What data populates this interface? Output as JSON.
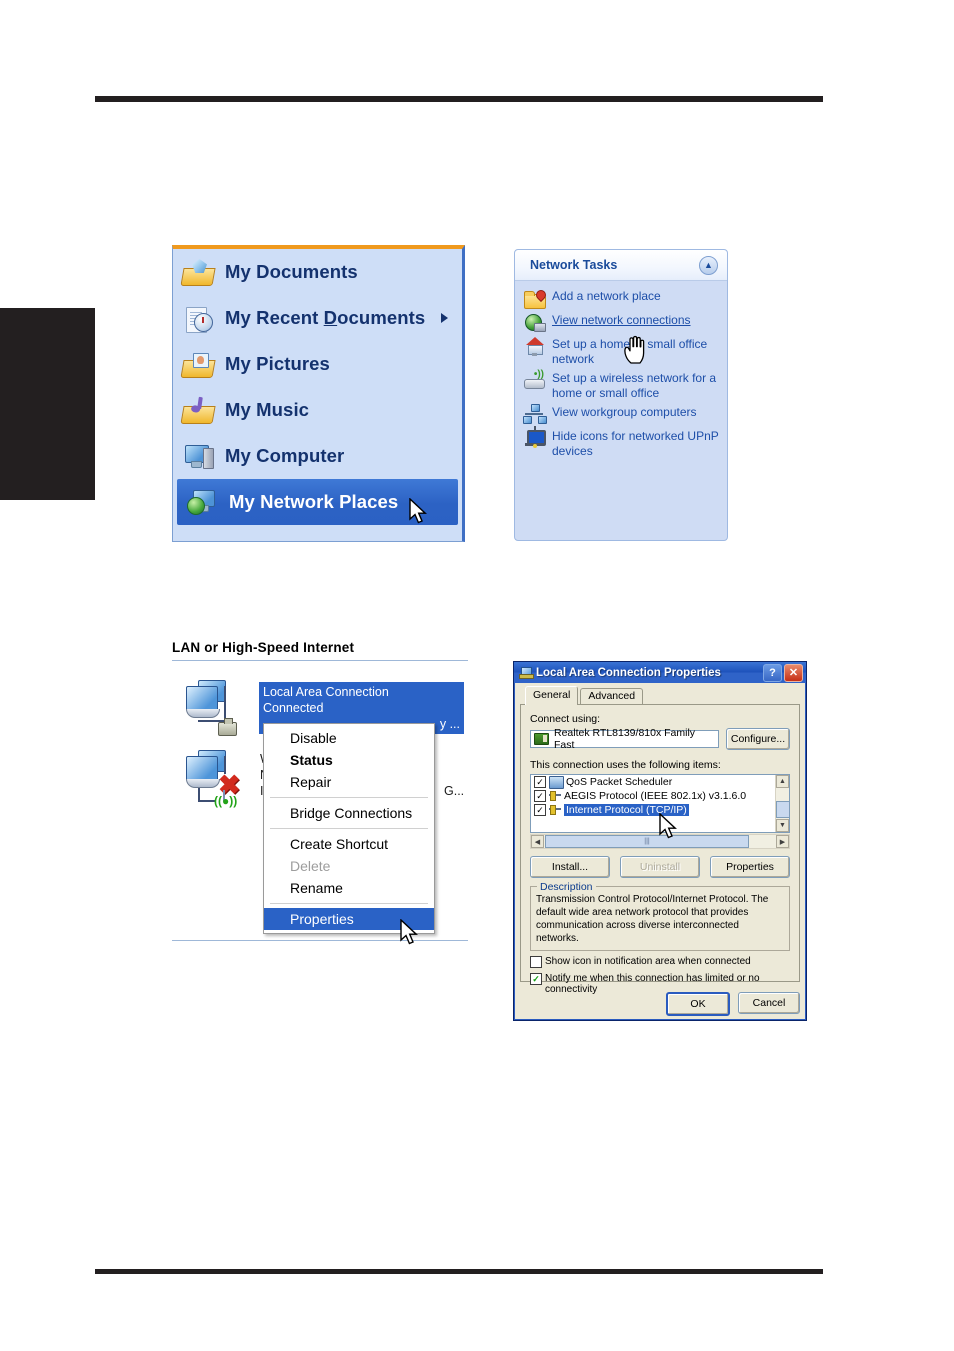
{
  "page": {
    "figures": 4
  },
  "start_menu": {
    "items": [
      {
        "label": "My Documents",
        "icon": "folder-documents-icon",
        "has_submenu": false,
        "selected": false
      },
      {
        "label": "My Recent Documents",
        "icon": "recent-documents-icon",
        "has_submenu": true,
        "selected": false,
        "accelerator": "D"
      },
      {
        "label": "My Pictures",
        "icon": "folder-pictures-icon",
        "has_submenu": false,
        "selected": false
      },
      {
        "label": "My Music",
        "icon": "folder-music-icon",
        "has_submenu": false,
        "selected": false
      },
      {
        "label": "My Computer",
        "icon": "my-computer-icon",
        "has_submenu": false,
        "selected": false
      },
      {
        "label": "My Network Places",
        "icon": "my-network-places-icon",
        "has_submenu": false,
        "selected": true
      }
    ],
    "accent_top": "#f09a1e",
    "background": "#cedef7",
    "selection_color": "#2c62c4"
  },
  "network_tasks": {
    "title": "Network Tasks",
    "collapse_icon": "chevron-up-icon",
    "items": [
      {
        "label": "Add a network place",
        "icon": "add-network-place-icon",
        "link": false
      },
      {
        "label": "View network connections",
        "icon": "view-network-connections-icon",
        "link": true
      },
      {
        "label": "Set up a home or small office network",
        "icon": "setup-home-network-icon",
        "link": false
      },
      {
        "label": "Set up a wireless network for a home or small office",
        "icon": "setup-wireless-network-icon",
        "link": false
      },
      {
        "label": "View workgroup computers",
        "icon": "view-workgroup-computers-icon",
        "link": false
      },
      {
        "label": "Hide icons for networked UPnP devices",
        "icon": "upnp-devices-icon",
        "link": false
      }
    ],
    "cursor": "hand-cursor",
    "background": "#cfdcf4",
    "link_color": "#1d4ea8"
  },
  "lan_section": {
    "heading": "LAN or High-Speed Internet",
    "connections": [
      {
        "name": "Local Area Connection",
        "status": "Connected",
        "detail": "y ...",
        "icon": "lan-connected-icon",
        "selected": true
      },
      {
        "name_partial": "W",
        "status_partial": "N",
        "detail_partial": "I",
        "trailing": "G...",
        "icon": "wireless-disconnected-icon",
        "selected": false
      }
    ]
  },
  "context_menu": {
    "items": [
      {
        "label": "Disable",
        "state": "normal"
      },
      {
        "label": "Status",
        "state": "bold"
      },
      {
        "label": "Repair",
        "state": "normal"
      },
      {
        "separator_after": true
      },
      {
        "label": "Bridge Connections",
        "state": "normal"
      },
      {
        "separator_after": true
      },
      {
        "label": "Create Shortcut",
        "state": "normal"
      },
      {
        "label": "Delete",
        "state": "disabled"
      },
      {
        "label": "Rename",
        "state": "normal"
      },
      {
        "separator_after": true
      },
      {
        "label": "Properties",
        "state": "highlight"
      }
    ],
    "cursor": "arrow-cursor",
    "highlight_color": "#2a62c6"
  },
  "properties_dialog": {
    "title": "Local Area Connection Properties",
    "title_icon": "network-connection-icon",
    "titlebar_buttons": [
      {
        "name": "help-button",
        "glyph": "?"
      },
      {
        "name": "close-button",
        "glyph": "✕"
      }
    ],
    "tabs": [
      {
        "label": "General",
        "active": true
      },
      {
        "label": "Advanced",
        "active": false
      }
    ],
    "connect_using_label": "Connect using:",
    "adapter": "Realtek RTL8139/810x Family Fast",
    "configure_button": "Configure...",
    "items_label": "This connection uses the following items:",
    "items": [
      {
        "label": "QoS Packet Scheduler",
        "checked": true,
        "selected": false,
        "icon": "qos-scheduler-icon"
      },
      {
        "label": "AEGIS Protocol (IEEE 802.1x) v3.1.6.0",
        "checked": true,
        "selected": false,
        "icon": "protocol-icon"
      },
      {
        "label": "Internet Protocol (TCP/IP)",
        "checked": true,
        "selected": true,
        "icon": "protocol-icon"
      }
    ],
    "buttons": [
      {
        "label": "Install...",
        "enabled": true,
        "name": "install-button"
      },
      {
        "label": "Uninstall",
        "enabled": false,
        "name": "uninstall-button"
      },
      {
        "label": "Properties",
        "enabled": true,
        "name": "properties-button"
      }
    ],
    "description_title": "Description",
    "description_text": "Transmission Control Protocol/Internet Protocol. The default wide area network protocol that provides communication across diverse interconnected networks.",
    "checkboxes": [
      {
        "label": "Show icon in notification area when connected",
        "checked": false,
        "name": "show-icon-checkbox"
      },
      {
        "label": "Notify me when this connection has limited or no connectivity",
        "checked": true,
        "name": "notify-limited-connectivity-checkbox"
      }
    ],
    "ok_button": "OK",
    "cancel_button": "Cancel",
    "scrollbar_up": "▲",
    "scrollbar_down": "▼",
    "scrollbar_left": "◀",
    "scrollbar_right": "▶",
    "titlebar_color": "#1d52bb",
    "face_color": "#ece9d8"
  }
}
